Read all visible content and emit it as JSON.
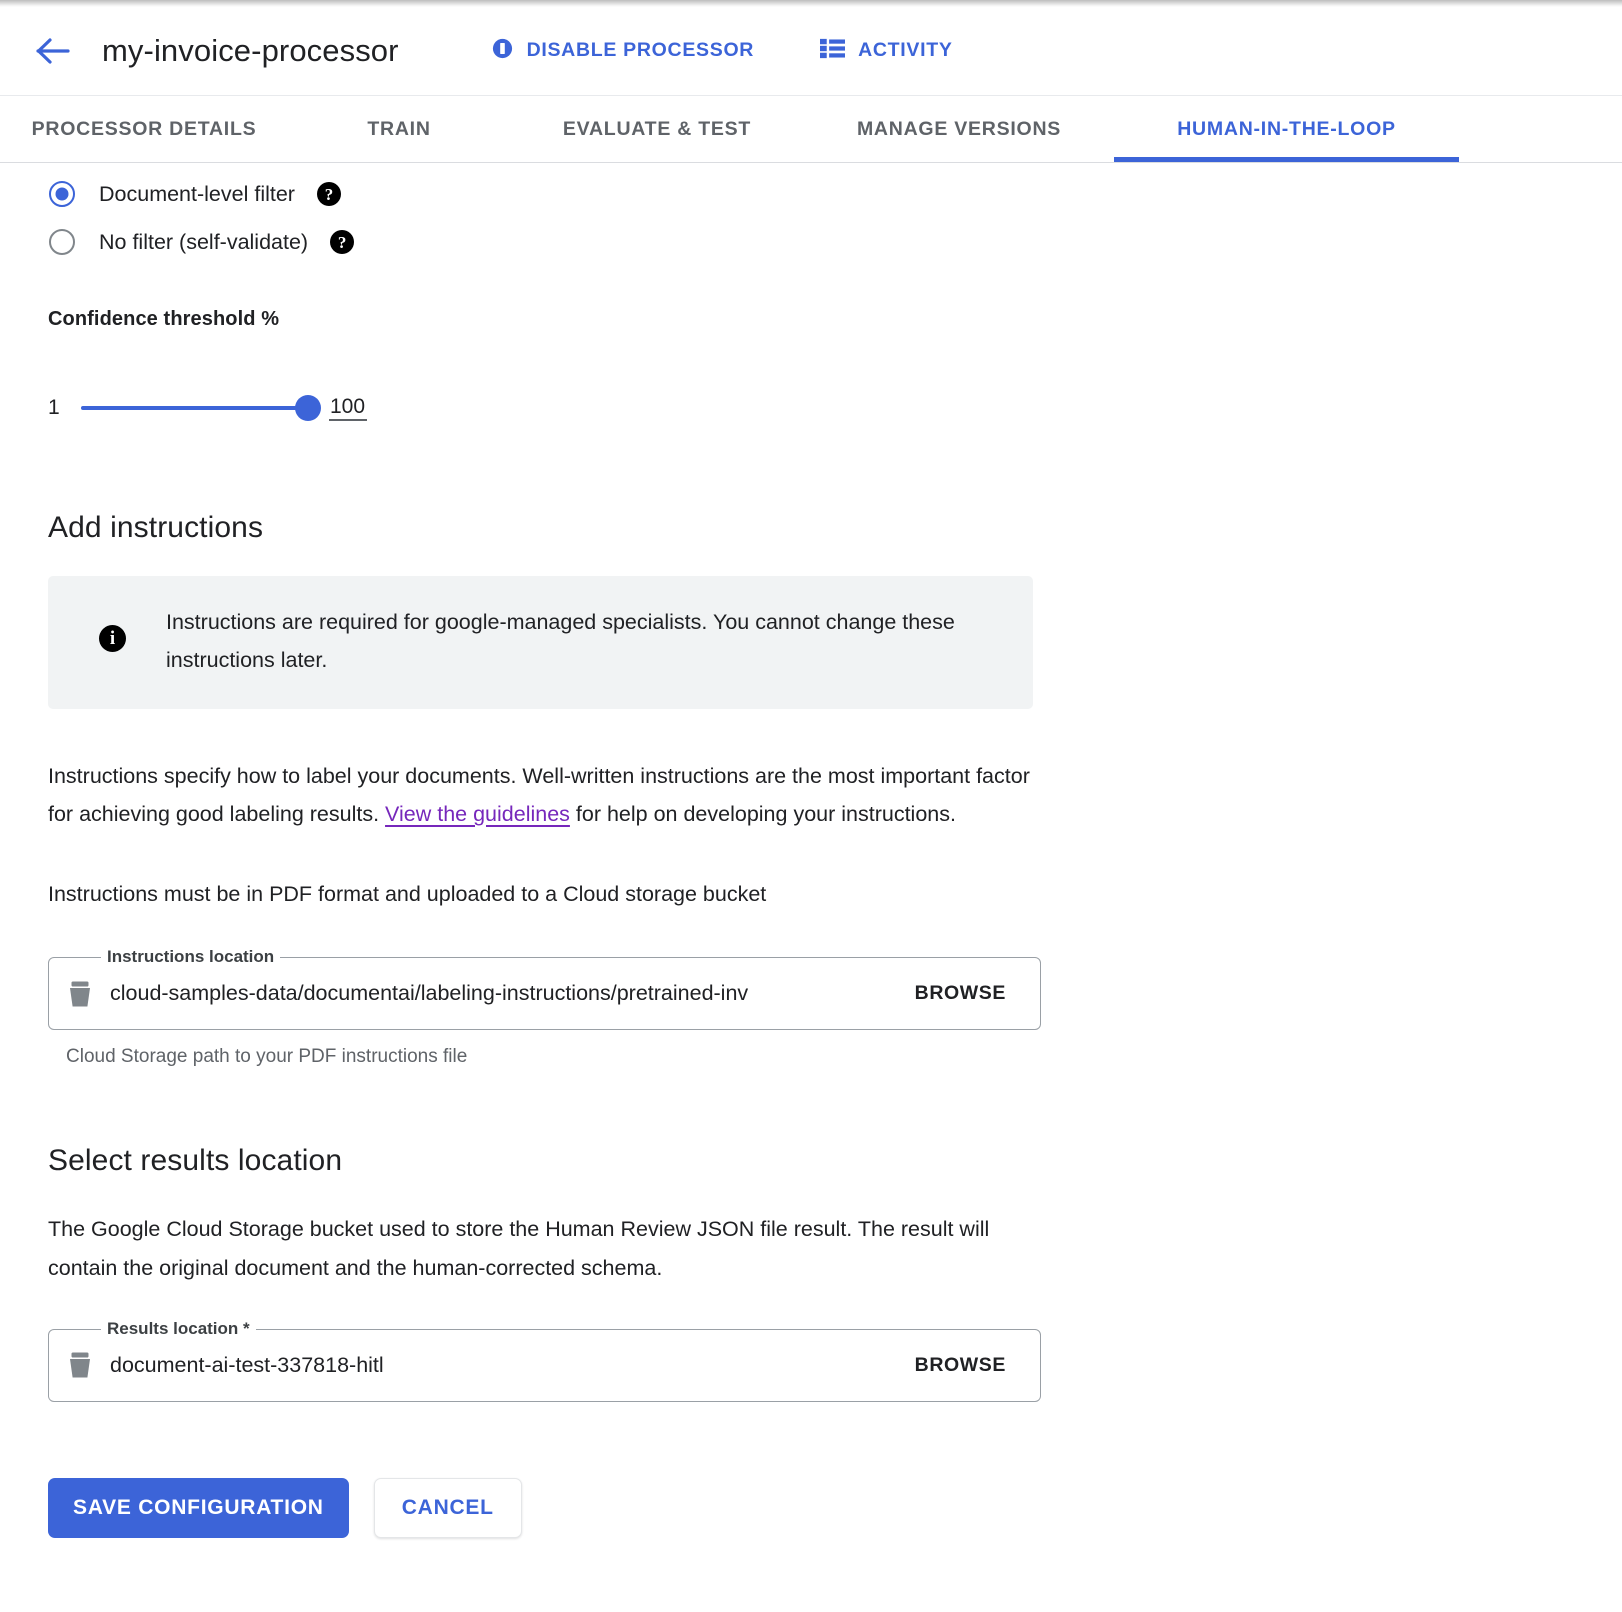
{
  "header": {
    "back_icon": "arrow-left-icon",
    "title": "my-invoice-processor",
    "actions": [
      {
        "icon": "disable-processor-icon",
        "label": "DISABLE PROCESSOR"
      },
      {
        "icon": "activity-list-icon",
        "label": "ACTIVITY"
      }
    ]
  },
  "tabs": [
    {
      "label": "PROCESSOR DETAILS",
      "active": false
    },
    {
      "label": "TRAIN",
      "active": false
    },
    {
      "label": "EVALUATE & TEST",
      "active": false
    },
    {
      "label": "MANAGE VERSIONS",
      "active": false
    },
    {
      "label": "HUMAN-IN-THE-LOOP",
      "active": true
    }
  ],
  "filter_options": [
    {
      "label": "Document-level filter",
      "selected": true,
      "help": "?"
    },
    {
      "label": "No filter (self-validate)",
      "selected": false,
      "help": "?"
    }
  ],
  "confidence": {
    "label": "Confidence threshold %",
    "min": "1",
    "max": "100",
    "value": "100"
  },
  "add_instructions": {
    "heading": "Add instructions",
    "info_icon": "info-icon",
    "info_text": "Instructions are required for google-managed specialists. You cannot change these instructions later.",
    "paragraph_part1": "Instructions specify how to label your documents. Well-written instructions are the most important factor for achieving good labeling results. ",
    "link_text": "View the guidelines",
    "paragraph_part2": " for help on developing your instructions.",
    "pdf_note": "Instructions must be in PDF format and uploaded to a Cloud storage bucket",
    "field": {
      "legend": "Instructions location",
      "icon": "bucket-icon",
      "value": "cloud-samples-data/documentai/labeling-instructions/pretrained-inv",
      "browse_label": "BROWSE",
      "hint": "Cloud Storage path to your PDF instructions file"
    }
  },
  "results_location": {
    "heading": "Select results location",
    "description": "The Google Cloud Storage bucket used to store the Human Review JSON file result. The result will contain the original document and the human-corrected schema.",
    "field": {
      "legend": "Results location *",
      "icon": "bucket-icon",
      "value": "document-ai-test-337818-hitl",
      "browse_label": "BROWSE"
    }
  },
  "footer_actions": {
    "save_label": "SAVE CONFIGURATION",
    "cancel_label": "CANCEL"
  },
  "colors": {
    "accent_blue": "#3c64d8",
    "link_purple": "#7627bb",
    "muted_text": "#5f6368",
    "info_bg": "#f1f3f4"
  }
}
